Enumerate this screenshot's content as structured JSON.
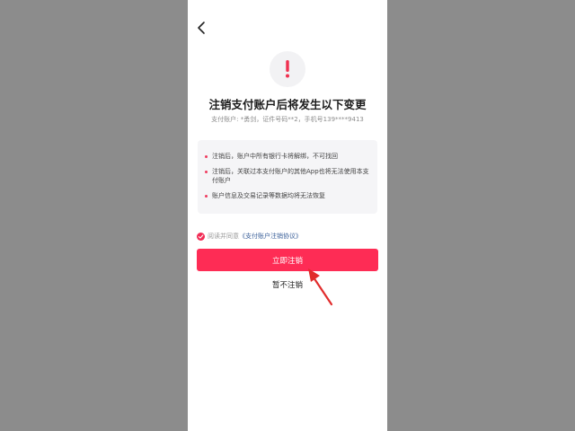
{
  "page": {
    "title": "注销支付账户后将发生以下变更",
    "subtitle": "支付账户: *勇剑，证件号码**2，手机号139****9413",
    "warning_symbol": "!"
  },
  "icons": {
    "back": "back-arrow-icon",
    "warning": "exclamation-icon",
    "check": "check-icon"
  },
  "notices": [
    {
      "text": "注销后，账户中所有银行卡将解绑，不可找回"
    },
    {
      "text": "注销后，关联过本支付账户的其他App也将无法使用本支付账户"
    },
    {
      "text": "账户信息及交易记录等数据均将无法恢复"
    }
  ],
  "agreement": {
    "prefix": "阅读并同意",
    "link": "《支付账户注销协议》",
    "checked": true
  },
  "actions": {
    "confirm_label": "立即注销",
    "cancel_label": "暂不注销"
  },
  "colors": {
    "primary": "#fe2c55",
    "link": "#3a5f99",
    "annotation_arrow": "#e12c2c"
  }
}
